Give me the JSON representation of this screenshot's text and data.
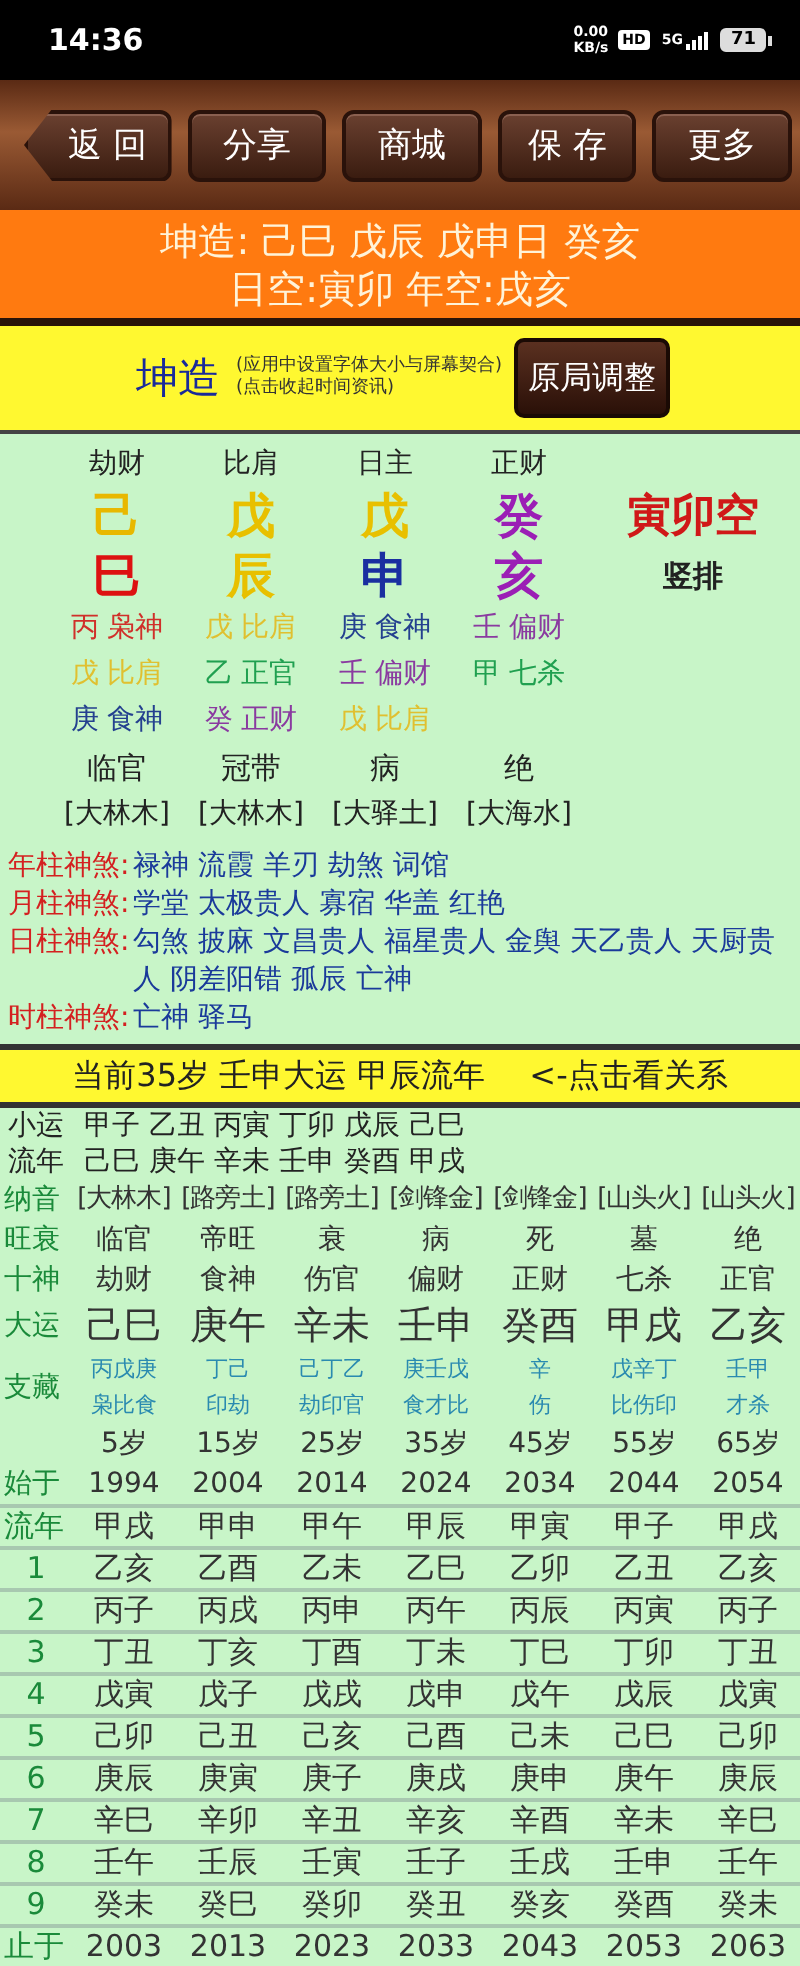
{
  "status_bar": {
    "time": "14:36",
    "net_speed": "0.00",
    "net_unit": "KB/s",
    "hd": "HD",
    "signal": "5G",
    "battery": "71"
  },
  "toolbar": [
    {
      "label": "返 回",
      "kind": "back"
    },
    {
      "label": "分享",
      "kind": "plain"
    },
    {
      "label": "商城",
      "kind": "plain"
    },
    {
      "label": "保 存",
      "kind": "plain"
    },
    {
      "label": "更多",
      "kind": "plain"
    }
  ],
  "banner": {
    "lines": [
      "坤造: 己巳 戊辰 戊申日 癸亥",
      "日空:寅卯 年空:戌亥"
    ]
  },
  "info_bar": {
    "title": "坤造",
    "notes": [
      "(应用中设置字体大小与屏幕契合)",
      "(点击收起时间资讯)"
    ],
    "button": "原局调整"
  },
  "pillars": [
    {
      "ten_god": "劫财",
      "stem": {
        "text": "己",
        "color": "#e8b800"
      },
      "branch": {
        "text": "巳",
        "color": "#dd1111"
      },
      "hidden": [
        {
          "text": "丙 枭神",
          "color": "#d0302a"
        },
        {
          "text": "戊 比肩",
          "color": "#e0c030"
        },
        {
          "text": "庚 食神",
          "color": "#24408f"
        }
      ],
      "stage": "临官",
      "nayin": "[大林木]"
    },
    {
      "ten_god": "比肩",
      "stem": {
        "text": "戊",
        "color": "#e8c000"
      },
      "branch": {
        "text": "辰",
        "color": "#e8c000"
      },
      "hidden": [
        {
          "text": "戊 比肩",
          "color": "#e0c030"
        },
        {
          "text": "乙 正官",
          "color": "#20a050"
        },
        {
          "text": "癸 正财",
          "color": "#8a3aa0"
        }
      ],
      "stage": "冠带",
      "nayin": "[大林木]"
    },
    {
      "ten_god": "日主",
      "stem": {
        "text": "戊",
        "color": "#e8c000"
      },
      "branch": {
        "text": "申",
        "color": "#1a2fa0"
      },
      "hidden": [
        {
          "text": "庚 食神",
          "color": "#24408f"
        },
        {
          "text": "壬 偏财",
          "color": "#8a3aa0"
        },
        {
          "text": "戊 比肩",
          "color": "#e0c030"
        }
      ],
      "stage": "病",
      "nayin": "[大驿土]"
    },
    {
      "ten_god": "正财",
      "stem": {
        "text": "癸",
        "color": "#9b1fb5"
      },
      "branch": {
        "text": "亥",
        "color": "#9b1fb5"
      },
      "hidden": [
        {
          "text": "壬 偏财",
          "color": "#8a3aa0"
        },
        {
          "text": "甲 七杀",
          "color": "#20a050"
        }
      ],
      "stage": "绝",
      "nayin": "[大海水]"
    }
  ],
  "void": "寅卯空",
  "layout_toggle": "竖排",
  "shensha": [
    {
      "label": "年柱神煞:",
      "text": "禄神 流霞 羊刃 劫煞 词馆"
    },
    {
      "label": "月柱神煞:",
      "text": "学堂  太极贵人 寡宿 华盖 红艳"
    },
    {
      "label": "日柱神煞:",
      "text": "勾煞 披麻 文昌贵人 福星贵人 金舆 天乙贵人 天厨贵人 阴差阳错 孤辰 亡神"
    },
    {
      "label": "时柱神煞:",
      "text": "亡神 驿马"
    }
  ],
  "current_bar": {
    "text": "当前35岁 壬申大运 甲辰流年",
    "link": "<-点击看关系"
  },
  "small_luck": {
    "label": "小运",
    "text": "甲子 乙丑 丙寅 丁卯 戊辰 己巳"
  },
  "years_line": {
    "label": "流年",
    "text": "己巳 庚午 辛未 壬申 癸酉 甲戌"
  },
  "luck_table": [
    {
      "kind": "plain",
      "label": "纳音",
      "cells": [
        "[大林木]",
        "[路旁土]",
        "[路旁土]",
        "[剑锋金]",
        "[剑锋金]",
        "[山头火]",
        "[山头火]"
      ]
    },
    {
      "kind": "plain",
      "label": "旺衰",
      "cells": [
        "临官",
        "帝旺",
        "衰",
        "病",
        "死",
        "墓",
        "绝"
      ]
    },
    {
      "kind": "plain",
      "label": "十神",
      "cells": [
        "劫财",
        "食神",
        "伤官",
        "偏财",
        "正财",
        "七杀",
        "正官"
      ]
    },
    {
      "kind": "big",
      "label": "大运",
      "cells": [
        "己巳",
        "庚午",
        "辛未",
        "壬申",
        "癸酉",
        "甲戌",
        "乙亥"
      ]
    },
    {
      "kind": "hidden",
      "label": "支藏",
      "cells": [
        [
          "丙戊庚",
          "枭比食"
        ],
        [
          "丁己",
          "印劫"
        ],
        [
          "己丁乙",
          "劫印官"
        ],
        [
          "庚壬戊",
          "食才比"
        ],
        [
          "辛",
          "伤"
        ],
        [
          "戊辛丁",
          "比伤印"
        ],
        [
          "壬甲",
          "才杀"
        ]
      ]
    },
    {
      "kind": "age",
      "cells": [
        "5岁",
        "15岁",
        "25岁",
        "35岁",
        "45岁",
        "55岁",
        "65岁"
      ]
    },
    {
      "kind": "plain",
      "label": "始于",
      "cells": [
        "1994",
        "2004",
        "2014",
        "2024",
        "2034",
        "2044",
        "2054"
      ]
    },
    {
      "kind": "lined",
      "label": "流年",
      "cells": [
        "甲戌",
        "甲申",
        "甲午",
        "甲辰",
        "甲寅",
        "甲子",
        "甲戌"
      ]
    },
    {
      "kind": "lined",
      "label": "1",
      "cells": [
        "乙亥",
        "乙酉",
        "乙未",
        "乙巳",
        "乙卯",
        "乙丑",
        "乙亥"
      ]
    },
    {
      "kind": "lined",
      "label": "2",
      "cells": [
        "丙子",
        "丙戌",
        "丙申",
        "丙午",
        "丙辰",
        "丙寅",
        "丙子"
      ]
    },
    {
      "kind": "lined",
      "label": "3",
      "cells": [
        "丁丑",
        "丁亥",
        "丁酉",
        "丁未",
        "丁巳",
        "丁卯",
        "丁丑"
      ]
    },
    {
      "kind": "lined",
      "label": "4",
      "cells": [
        "戊寅",
        "戊子",
        "戊戌",
        "戊申",
        "戊午",
        "戊辰",
        "戊寅"
      ]
    },
    {
      "kind": "lined",
      "label": "5",
      "cells": [
        "己卯",
        "己丑",
        "己亥",
        "己酉",
        "己未",
        "己巳",
        "己卯"
      ]
    },
    {
      "kind": "lined",
      "label": "6",
      "cells": [
        "庚辰",
        "庚寅",
        "庚子",
        "庚戌",
        "庚申",
        "庚午",
        "庚辰"
      ]
    },
    {
      "kind": "lined",
      "label": "7",
      "cells": [
        "辛巳",
        "辛卯",
        "辛丑",
        "辛亥",
        "辛酉",
        "辛未",
        "辛巳"
      ]
    },
    {
      "kind": "lined",
      "label": "8",
      "cells": [
        "壬午",
        "壬辰",
        "壬寅",
        "壬子",
        "壬戌",
        "壬申",
        "壬午"
      ]
    },
    {
      "kind": "lined",
      "label": "9",
      "cells": [
        "癸未",
        "癸巳",
        "癸卯",
        "癸丑",
        "癸亥",
        "癸酉",
        "癸未"
      ]
    },
    {
      "kind": "lined",
      "label": "止于",
      "cells": [
        "2003",
        "2013",
        "2023",
        "2033",
        "2043",
        "2053",
        "2063"
      ]
    }
  ]
}
